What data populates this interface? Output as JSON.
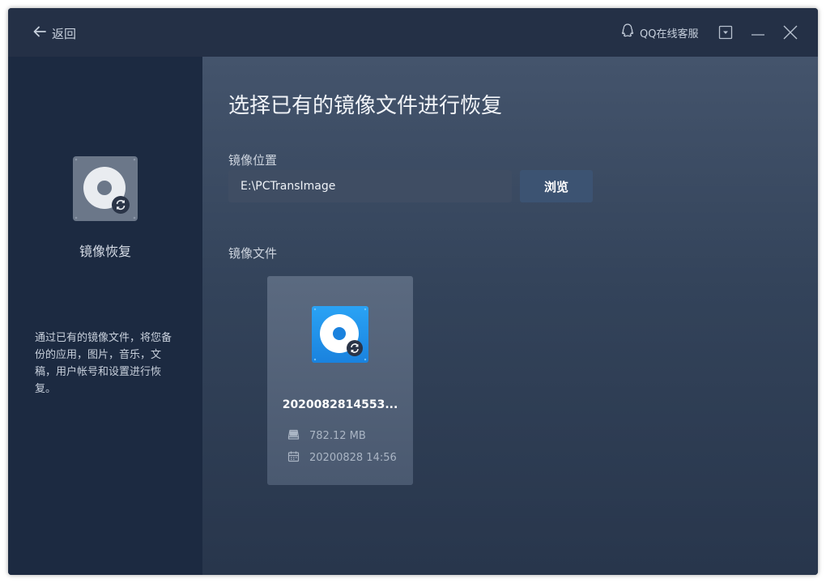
{
  "titlebar": {
    "back_label": "返回",
    "support_label": "QQ在线客服"
  },
  "sidebar": {
    "title": "镜像恢复",
    "description": "通过已有的镜像文件，将您备份的应用，图片，音乐，文稿，用户帐号和设置进行恢复。"
  },
  "main": {
    "title": "选择已有的镜像文件进行恢复",
    "location_label": "镜像位置",
    "path_value": "E:\\PCTransImage",
    "browse_label": "浏览",
    "files_label": "镜像文件",
    "files": [
      {
        "name": "2020082814553...",
        "size": "782.12 MB",
        "date": "20200828 14:56"
      }
    ]
  },
  "colors": {
    "accent": "#1a82de",
    "window_bg": "#26344a",
    "sidebar_bg": "#1c2a41"
  },
  "icons": [
    "arrow-left-icon",
    "qq-icon",
    "dropdown-icon",
    "minimize-icon",
    "close-icon",
    "disk-restore-icon",
    "drive-icon",
    "calendar-icon"
  ]
}
